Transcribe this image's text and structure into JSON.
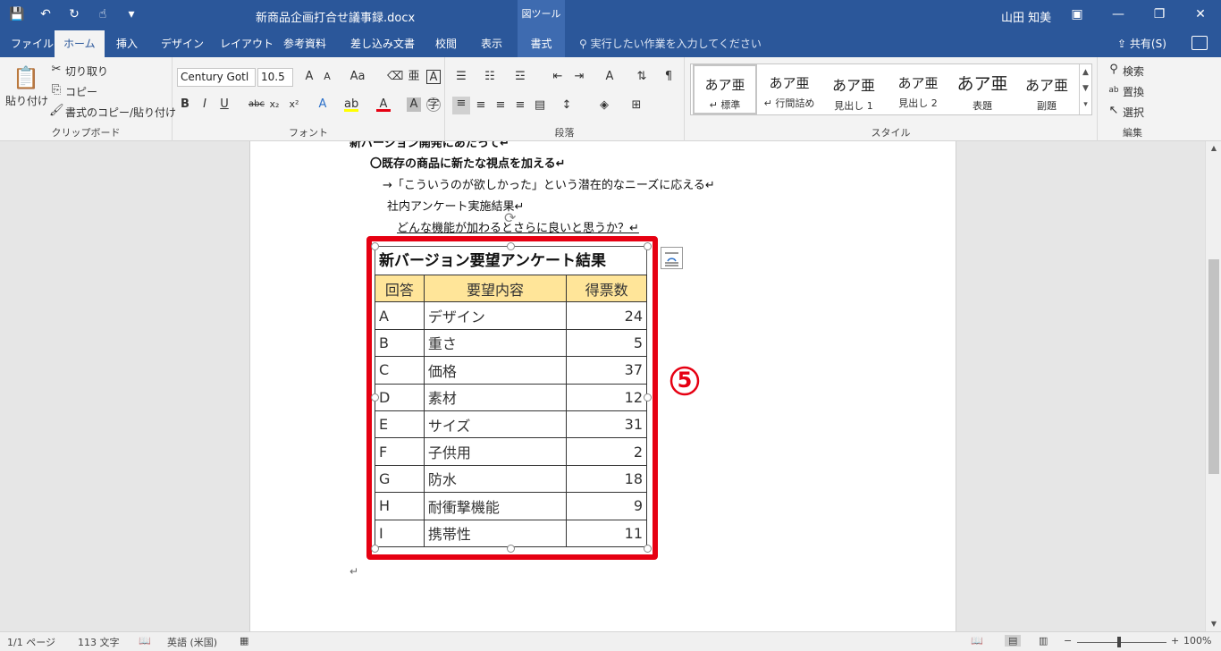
{
  "window": {
    "title": "新商品企画打合せ議事録.docx",
    "context_tab_group": "図ツール",
    "user": "山田 知美"
  },
  "tabs": [
    {
      "label": "ファイル"
    },
    {
      "label": "ホーム"
    },
    {
      "label": "挿入"
    },
    {
      "label": "デザイン"
    },
    {
      "label": "レイアウト"
    },
    {
      "label": "参考資料"
    },
    {
      "label": "差し込み文書"
    },
    {
      "label": "校閲"
    },
    {
      "label": "表示"
    },
    {
      "label": "書式"
    }
  ],
  "tell_me": "実行したい作業を入力してください",
  "share": "共有(S)",
  "ribbon": {
    "clipboard": {
      "label": "クリップボード",
      "paste": "貼り付け",
      "cut": "切り取り",
      "copy": "コピー",
      "format_painter": "書式のコピー/貼り付け"
    },
    "font": {
      "label": "フォント",
      "font_name": "Century Gotl",
      "font_size": "10.5"
    },
    "paragraph": {
      "label": "段落"
    },
    "styles": {
      "label": "スタイル",
      "items": [
        {
          "sample": "あア亜",
          "name": "↵ 標準"
        },
        {
          "sample": "あア亜",
          "name": "↵ 行間詰め"
        },
        {
          "sample": "あア亜",
          "name": "見出し 1"
        },
        {
          "sample": "あア亜",
          "name": "見出し 2"
        },
        {
          "sample": "あア亜",
          "name": "表題"
        },
        {
          "sample": "あア亜",
          "name": "副題"
        }
      ]
    },
    "editing": {
      "label": "編集",
      "find": "検索",
      "replace": "置換",
      "select": "選択"
    }
  },
  "document": {
    "lines": [
      "新バージョン開発にあたって↵",
      "〇既存の商品に新たな視点を加える↵",
      "→「こういうのが欲しかった」という潜在的なニーズに応える↵",
      "社内アンケート実施結果↵",
      "どんな機能が加わるとさらに良いと思うか？↵"
    ],
    "table": {
      "title": "新バージョン要望アンケート結果",
      "headers": [
        "回答",
        "要望内容",
        "得票数"
      ],
      "rows": [
        [
          "A",
          "デザイン",
          "24"
        ],
        [
          "B",
          "重さ",
          "5"
        ],
        [
          "C",
          "価格",
          "37"
        ],
        [
          "D",
          "素材",
          "12"
        ],
        [
          "E",
          "サイズ",
          "31"
        ],
        [
          "F",
          "子供用",
          "2"
        ],
        [
          "G",
          "防水",
          "18"
        ],
        [
          "H",
          "耐衝撃機能",
          "9"
        ],
        [
          "I",
          "携帯性",
          "11"
        ]
      ]
    },
    "callout": "5",
    "accent_color": "#e60012",
    "header_fill": "#ffe599"
  },
  "status": {
    "page": "1/1 ページ",
    "words": "113 文字",
    "language": "英語 (米国)",
    "zoom": "100%"
  },
  "colors": {
    "brand": "#2b579a"
  }
}
